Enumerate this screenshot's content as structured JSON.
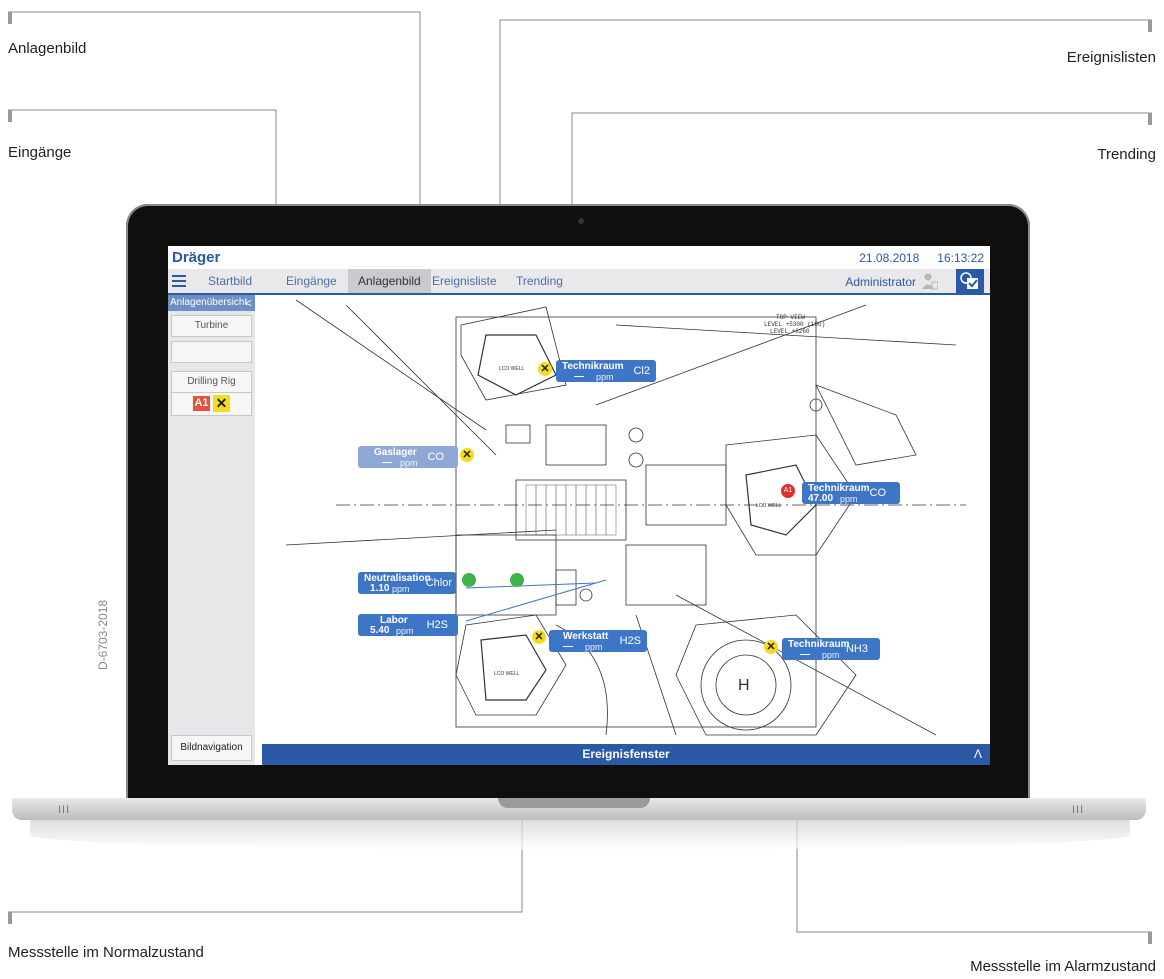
{
  "callouts": {
    "anlagenbild": "Anlagenbild",
    "eingaenge": "Eingänge",
    "ereignislisten": "Ereignislisten",
    "trending": "Trending",
    "normal": "Messstelle im Normalzustand",
    "alarm": "Messstelle im Alarmzustand"
  },
  "doc_code": "D-6703-2018",
  "app": {
    "logo": "Dräger",
    "date": "21.08.2018",
    "time": "16:13:22",
    "tabs": [
      "Startbild",
      "Eingänge",
      "Anlagenbild",
      "Ereignisliste",
      "Trending"
    ],
    "active_tab": "Anlagenbild",
    "user": "Administrator",
    "colors": {
      "accent": "#2a5aa6",
      "alarm": "#e8503a",
      "fault": "#f4dc1e",
      "normal": "#3fb24a"
    }
  },
  "sidebar": {
    "header": "Anlagenübersicht",
    "items": [
      "Turbine",
      "",
      "Drilling Rig"
    ],
    "alarm_badge": "A1",
    "fault_badge": "✕",
    "nav_button": "Bildnavigation"
  },
  "drawing": {
    "title_line1": "TOP VIEW",
    "title_line2": "LEVEL +5300 (10G)",
    "title_line3": "LEVEL +8260",
    "label_lcd1": "LCO WELL",
    "label_lcd2": "LCO WELL",
    "label_lcd3": "LCO WELL"
  },
  "sensors": [
    {
      "name": "Technikraum",
      "value": "—",
      "unit": "ppm",
      "gas": "Cl2",
      "state": "fault"
    },
    {
      "name": "Gaslager",
      "value": "—",
      "unit": "ppm",
      "gas": "CO",
      "state": "fault"
    },
    {
      "name": "Technikraum",
      "value": "47.00",
      "unit": "ppm",
      "gas": "CO",
      "state": "alarm",
      "badge": "A1"
    },
    {
      "name": "Neutralisation",
      "value": "1.10",
      "unit": "ppm",
      "gas": "Chlor",
      "state": "normal"
    },
    {
      "name": "Labor",
      "value": "5.40",
      "unit": "ppm",
      "gas": "H2S",
      "state": "normal"
    },
    {
      "name": "Werkstatt",
      "value": "—",
      "unit": "ppm",
      "gas": "H2S",
      "state": "fault"
    },
    {
      "name": "Technikraum",
      "value": "—",
      "unit": "ppm",
      "gas": "NH3",
      "state": "fault"
    }
  ],
  "event_window": {
    "label": "Ereignisfenster",
    "toggle": "Λ"
  }
}
